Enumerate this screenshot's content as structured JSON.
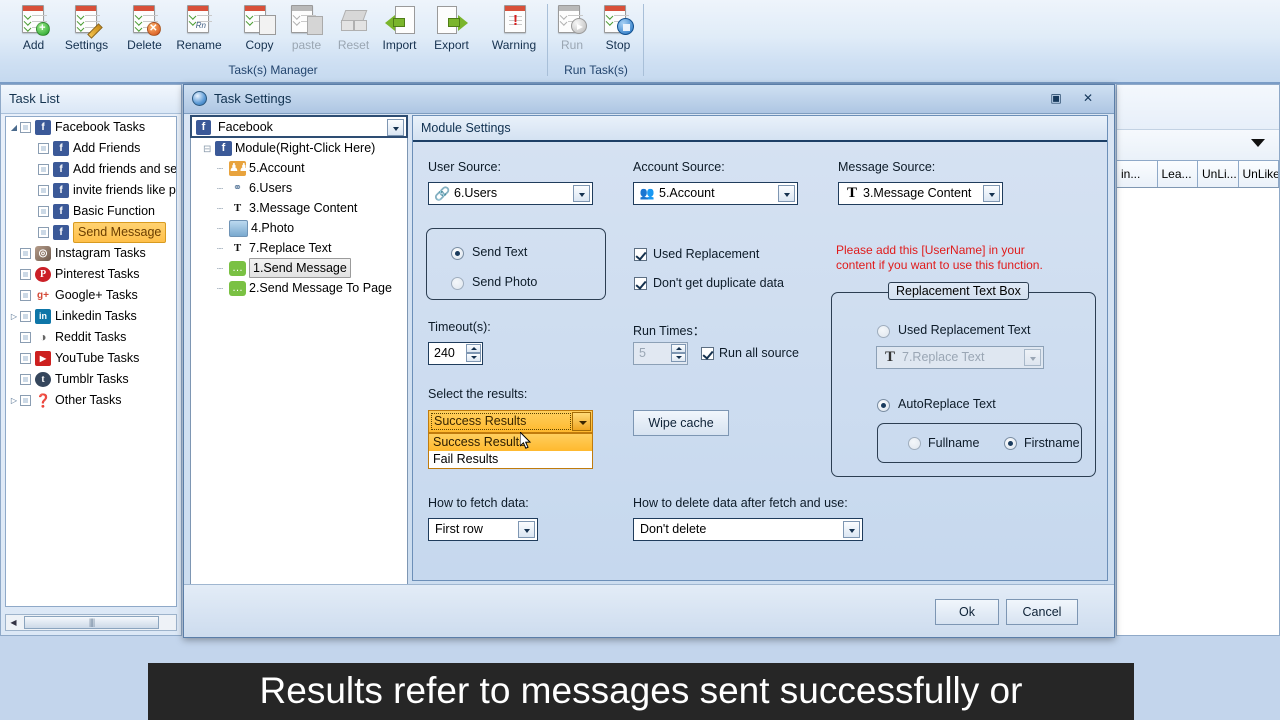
{
  "ribbon": {
    "buttons": [
      {
        "label": "Add",
        "icon": "add-task-icon",
        "enabled": true
      },
      {
        "label": "Settings",
        "icon": "settings-task-icon",
        "enabled": true
      },
      {
        "label": "Delete",
        "icon": "delete-task-icon",
        "enabled": true
      },
      {
        "label": "Rename",
        "icon": "rename-task-icon",
        "enabled": true
      },
      {
        "label": "Copy",
        "icon": "copy-task-icon",
        "enabled": true
      },
      {
        "label": "paste",
        "icon": "paste-task-icon",
        "enabled": false
      },
      {
        "label": "Reset",
        "icon": "reset-task-icon",
        "enabled": false
      },
      {
        "label": "Import",
        "icon": "import-icon",
        "enabled": true
      },
      {
        "label": "Export",
        "icon": "export-icon",
        "enabled": true
      },
      {
        "label": "Warning",
        "icon": "warning-icon",
        "enabled": true
      }
    ],
    "group1_caption": "Task(s) Manager",
    "run_buttons": [
      {
        "label": "Run",
        "icon": "run-icon",
        "enabled": false
      },
      {
        "label": "Stop",
        "icon": "stop-icon",
        "enabled": true
      }
    ],
    "group2_caption": "Run Task(s)"
  },
  "task_list": {
    "header": "Task List",
    "items": [
      {
        "label": "Facebook Tasks",
        "icon": "facebook-icon",
        "indent": 0,
        "expander": "expanded",
        "selected": false
      },
      {
        "label": "Add Friends",
        "icon": "facebook-icon",
        "indent": 1,
        "expander": "none",
        "selected": false
      },
      {
        "label": "Add friends and se",
        "icon": "facebook-icon",
        "indent": 1,
        "expander": "none",
        "selected": false
      },
      {
        "label": "invite friends like p",
        "icon": "facebook-icon",
        "indent": 1,
        "expander": "none",
        "selected": false
      },
      {
        "label": "Basic Function",
        "icon": "facebook-icon",
        "indent": 1,
        "expander": "none",
        "selected": false
      },
      {
        "label": "Send Message",
        "icon": "facebook-icon",
        "indent": 1,
        "expander": "none",
        "selected": true
      },
      {
        "label": "Instagram Tasks",
        "icon": "instagram-icon",
        "indent": 0,
        "expander": "none",
        "selected": false
      },
      {
        "label": "Pinterest Tasks",
        "icon": "pinterest-icon",
        "indent": 0,
        "expander": "none",
        "selected": false
      },
      {
        "label": "Google+ Tasks",
        "icon": "googleplus-icon",
        "indent": 0,
        "expander": "none",
        "selected": false
      },
      {
        "label": "Linkedin Tasks",
        "icon": "linkedin-icon",
        "indent": 0,
        "expander": "collapsed",
        "selected": false
      },
      {
        "label": "Reddit Tasks",
        "icon": "reddit-icon",
        "indent": 0,
        "expander": "none",
        "selected": false
      },
      {
        "label": "YouTube Tasks",
        "icon": "youtube-icon",
        "indent": 0,
        "expander": "none",
        "selected": false
      },
      {
        "label": "Tumblr Tasks",
        "icon": "tumblr-icon",
        "indent": 0,
        "expander": "none",
        "selected": false
      },
      {
        "label": "Other Tasks",
        "icon": "question-icon",
        "indent": 0,
        "expander": "collapsed",
        "selected": false
      }
    ]
  },
  "background_grid": {
    "columns": [
      "in...",
      "Lea...",
      "UnLi...",
      "UnLike..."
    ]
  },
  "dialog": {
    "title": "Task Settings",
    "restore_glyph": "▣",
    "close_glyph": "✕",
    "platform_combo": {
      "value": "Facebook",
      "icon": "facebook-icon"
    },
    "module_tree": [
      {
        "label": "Module(Right-Click Here)",
        "icon": "facebook-icon",
        "root": true,
        "selected": false
      },
      {
        "label": "5.Account",
        "icon": "account-group-icon",
        "root": false,
        "selected": false
      },
      {
        "label": "6.Users",
        "icon": "users-link-icon",
        "root": false,
        "selected": false
      },
      {
        "label": "3.Message Content",
        "icon": "text-T-icon",
        "root": false,
        "selected": false
      },
      {
        "label": "4.Photo",
        "icon": "photo-icon",
        "root": false,
        "selected": false
      },
      {
        "label": "7.Replace Text",
        "icon": "text-T-icon",
        "root": false,
        "selected": false
      },
      {
        "label": "1.Send Message",
        "icon": "message-icon",
        "root": false,
        "selected": true
      },
      {
        "label": "2.Send Message To Page",
        "icon": "message-icon",
        "root": false,
        "selected": false
      }
    ],
    "module_settings": {
      "header": "Module Settings",
      "user_source_label": "User Source:",
      "user_source_value": "6.Users",
      "user_source_icon": "users-link-icon",
      "account_source_label": "Account Source:",
      "account_source_value": "5.Account",
      "account_source_icon": "account-group-icon",
      "message_source_label": "Message Source:",
      "message_source_value": "3.Message Content",
      "message_source_icon": "text-T-icon",
      "send_text_label": "Send Text",
      "send_text_selected": true,
      "send_photo_label": "Send Photo",
      "send_photo_selected": false,
      "used_replacement_label": "Used  Replacement",
      "used_replacement_checked": true,
      "no_duplicate_label": "Don't get duplicate data",
      "no_duplicate_checked": true,
      "hint_line1": "Please add this [UserName] in your",
      "hint_line2": "content if you want to use this function.",
      "hint_color": "#e01b1b",
      "timeout_label": "Timeout(s):",
      "timeout_value": "240",
      "run_times_label": "Run Times：",
      "run_times_value": "5",
      "run_all_source_label": "Run all source",
      "run_all_source_checked": true,
      "select_results_label": "Select the results:",
      "results_value": "Success Results",
      "results_options": [
        "Success Results",
        "Fail Results"
      ],
      "results_highlighted": "Success Results",
      "wipe_cache_label": "Wipe cache",
      "fetch_label": "How to fetch data:",
      "fetch_value": "First row",
      "delete_label": "How to delete data after fetch and use:",
      "delete_value": "Don't delete",
      "replacement_box": {
        "title": "Replacement Text Box",
        "used_replacement_text_label": "Used Replacement Text",
        "used_replacement_text_selected": false,
        "replace_text_value": "7.Replace Text",
        "replace_text_icon": "text-T-icon",
        "autoreplace_label": "AutoReplace Text",
        "autoreplace_selected": true,
        "fullname_label": "Fullname",
        "fullname_selected": false,
        "firstname_label": "Firstname",
        "firstname_selected": true
      }
    },
    "ok_label": "Ok",
    "cancel_label": "Cancel"
  },
  "subtitle": {
    "text": "Results refer to messages sent successfully or"
  }
}
